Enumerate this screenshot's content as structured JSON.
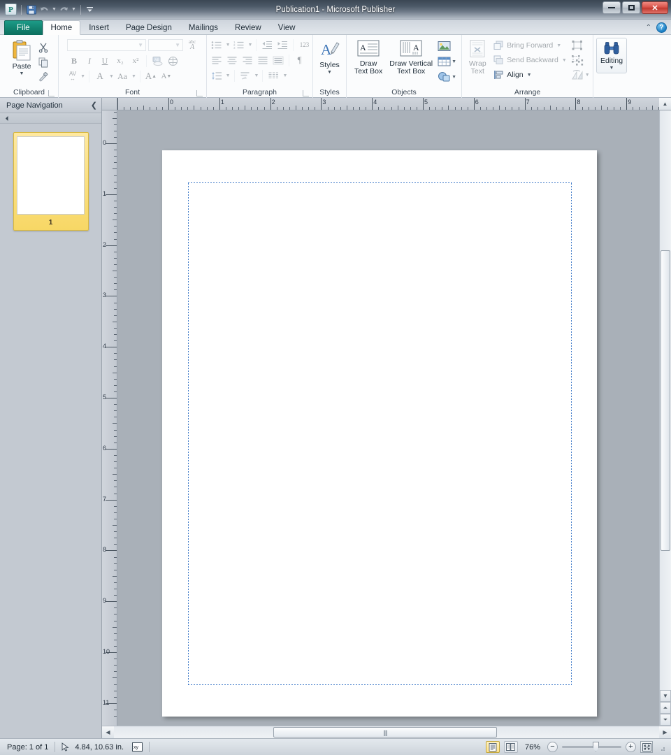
{
  "titlebar": {
    "document_title": "Publication1",
    "app_name": "Microsoft Publisher",
    "full_title": "Publication1 - Microsoft Publisher",
    "quick_access": [
      {
        "name": "publisher-logo-icon",
        "label": "P"
      },
      {
        "name": "save-icon",
        "label": "Save"
      },
      {
        "name": "undo-icon",
        "label": "Undo"
      },
      {
        "name": "redo-icon",
        "label": "Redo"
      },
      {
        "name": "customize-qat-icon",
        "label": "Customize Quick Access Toolbar"
      }
    ],
    "window_controls": {
      "minimize": "Minimize",
      "maximize": "Restore Down",
      "close": "Close",
      "close_glyph": "✕"
    }
  },
  "tabs": [
    {
      "id": "file",
      "label": "File"
    },
    {
      "id": "home",
      "label": "Home"
    },
    {
      "id": "insert",
      "label": "Insert"
    },
    {
      "id": "page-design",
      "label": "Page Design"
    },
    {
      "id": "mailings",
      "label": "Mailings"
    },
    {
      "id": "review",
      "label": "Review"
    },
    {
      "id": "view",
      "label": "View"
    }
  ],
  "active_tab": "Home",
  "tab_right": {
    "collapse_ribbon": "^",
    "help": "?"
  },
  "ribbon": {
    "groups": [
      {
        "id": "clipboard",
        "title": "Clipboard",
        "paste_label": "Paste",
        "buttons": [
          {
            "name": "paste-button",
            "label": "Paste"
          },
          {
            "name": "cut-button",
            "label": "Cut"
          },
          {
            "name": "copy-button",
            "label": "Copy"
          },
          {
            "name": "format-painter-button",
            "label": "Format Painter"
          }
        ]
      },
      {
        "id": "font",
        "title": "Font",
        "font_name_value": "",
        "font_name_placeholder": "",
        "font_size_value": "",
        "buttons": [
          {
            "name": "bold-button",
            "label": "B"
          },
          {
            "name": "italic-button",
            "label": "I"
          },
          {
            "name": "underline-button",
            "label": "U"
          },
          {
            "name": "subscript-button",
            "label": "x₂"
          },
          {
            "name": "superscript-button",
            "label": "x²"
          },
          {
            "name": "text-effects-button",
            "label": "Text Effects"
          },
          {
            "name": "character-spacing-button",
            "label": "AV"
          },
          {
            "name": "font-color-button",
            "label": "A"
          },
          {
            "name": "change-case-button",
            "label": "Aa"
          },
          {
            "name": "grow-font-button",
            "label": "A"
          },
          {
            "name": "shrink-font-button",
            "label": "A"
          },
          {
            "name": "clear-formatting-button",
            "label": "abc A"
          },
          {
            "name": "spacing-special-button",
            "label": "⊜"
          }
        ]
      },
      {
        "id": "paragraph",
        "title": "Paragraph",
        "buttons": [
          {
            "name": "bullets-button",
            "label": "Bullets"
          },
          {
            "name": "numbering-button",
            "label": "Numbering"
          },
          {
            "name": "decrease-indent-button",
            "label": "Decrease Indent"
          },
          {
            "name": "increase-indent-button",
            "label": "Increase Indent"
          },
          {
            "name": "numbering-style-button",
            "label": "123"
          },
          {
            "name": "align-left-button",
            "label": "Align Left"
          },
          {
            "name": "center-button",
            "label": "Center"
          },
          {
            "name": "align-right-button",
            "label": "Align Right"
          },
          {
            "name": "justify-button",
            "label": "Justify"
          },
          {
            "name": "distribute-button",
            "label": "Distribute"
          },
          {
            "name": "show-formatting-marks-button",
            "label": "¶"
          },
          {
            "name": "line-spacing-button",
            "label": "Line Spacing"
          },
          {
            "name": "hyphenation-button",
            "label": "Hyphenation"
          },
          {
            "name": "columns-button",
            "label": "Columns"
          }
        ]
      },
      {
        "id": "styles",
        "title": "Styles",
        "styles_label": "Styles"
      },
      {
        "id": "objects",
        "title": "Objects",
        "draw_text_box_label": "Draw\nText Box",
        "draw_text_box_line1": "Draw",
        "draw_text_box_line2": "Text Box",
        "draw_vertical_line1": "Draw Vertical",
        "draw_vertical_line2": "Text Box",
        "buttons": [
          {
            "name": "picture-button",
            "label": "Picture"
          },
          {
            "name": "table-button",
            "label": "Table"
          },
          {
            "name": "shapes-button",
            "label": "Shapes"
          }
        ]
      },
      {
        "id": "arrange",
        "title": "Arrange",
        "wrap_text_line1": "Wrap",
        "wrap_text_line2": "Text",
        "bring_forward_label": "Bring Forward",
        "send_backward_label": "Send Backward",
        "align_label": "Align",
        "buttons": [
          {
            "name": "group-button",
            "label": "Group"
          },
          {
            "name": "ungroup-button",
            "label": "Ungroup"
          },
          {
            "name": "rotate-button",
            "label": "Rotate"
          }
        ]
      },
      {
        "id": "editing",
        "title": "",
        "editing_label": "Editing"
      }
    ]
  },
  "navpane": {
    "title": "Page Navigation",
    "collapse_glyph": "❮",
    "pages": [
      {
        "number": "1",
        "selected": true
      }
    ]
  },
  "rulers": {
    "horizontal_unit": "in",
    "horizontal_ticks": [
      "0",
      "1",
      "2",
      "3",
      "4",
      "5",
      "6",
      "7",
      "8",
      "9"
    ],
    "vertical_ticks": [
      "0",
      "1",
      "2",
      "3",
      "4",
      "5",
      "6",
      "7",
      "8",
      "9",
      "10",
      "11"
    ]
  },
  "canvas": {
    "page_label": "Publication page 1",
    "margin_guide_color": "#3c78c8"
  },
  "statusbar": {
    "page_label": "Page: 1 of 1",
    "cursor_position": "4.84, 10.63 in.",
    "object_size_icon": "object-size-icon",
    "zoom_level": "76%",
    "zoom_out_glyph": "−",
    "zoom_in_glyph": "+",
    "single_page_view": "Single Page View",
    "two_page_spread_view": "Two-Page Spread",
    "fit_window": "Fit Page to Current Window"
  }
}
